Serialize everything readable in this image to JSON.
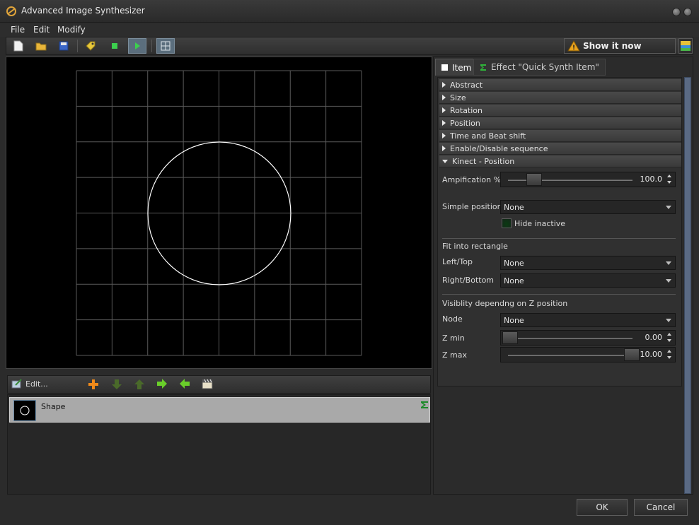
{
  "window": {
    "title": "Advanced Image Synthesizer"
  },
  "menu": {
    "items": [
      "File",
      "Edit",
      "Modify"
    ]
  },
  "toolbar": {
    "show_label": "Show it now",
    "icons": [
      "new-file-icon",
      "open-folder-icon",
      "save-icon",
      "tag-icon",
      "stop-icon",
      "play-icon",
      "grid-icon"
    ]
  },
  "sequence": {
    "edit_label": "Edit...",
    "items": [
      {
        "label": "Shape"
      }
    ]
  },
  "tabs": {
    "item": "Item",
    "effect": "Effect \"Quick Synth Item\""
  },
  "sections": {
    "abstract": "Abstract",
    "size": "Size",
    "rotation": "Rotation",
    "position": "Position",
    "time": "Time and Beat shift",
    "enable": "Enable/Disable sequence",
    "kinect": "Kinect - Position"
  },
  "kinect": {
    "amplification_label": "Ampification %",
    "amplification_value": "100.0",
    "amplification_level": 0.2,
    "simple_position_label": "Simple position",
    "simple_position_value": "None",
    "hide_inactive_label": "Hide inactive",
    "fit_label": "Fit into rectangle",
    "left_top_label": "Left/Top",
    "left_top_value": "None",
    "right_bottom_label": "Right/Bottom",
    "right_bottom_value": "None",
    "visibility_label": "Visiblity dependng on Z position",
    "node_label": "Node",
    "node_value": "None",
    "zmin_label": "Z min",
    "zmin_value": "0.00",
    "zmin_level": 0.0,
    "zmax_label": "Z max",
    "zmax_value": "10.00",
    "zmax_level": 1.0
  },
  "buttons": {
    "ok": "OK",
    "cancel": "Cancel"
  },
  "colors": {
    "accent_green": "#3ccf4e",
    "scrollbar": "#5a6a84",
    "warning": "#e8a21c"
  }
}
